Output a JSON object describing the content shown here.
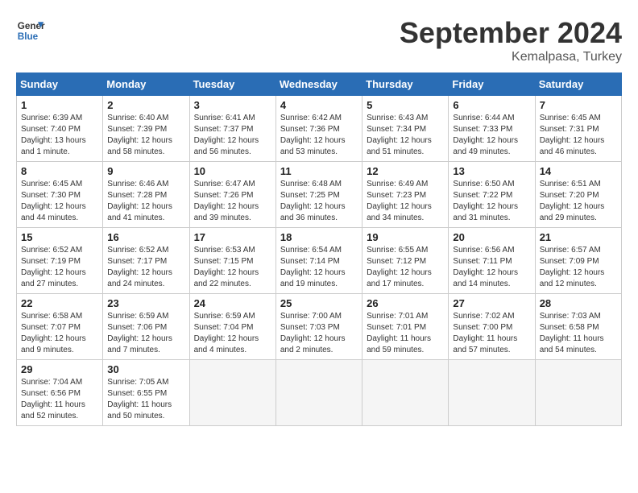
{
  "header": {
    "month_title": "September 2024",
    "location": "Kemalpasa, Turkey",
    "logo_line1": "General",
    "logo_line2": "Blue"
  },
  "weekdays": [
    "Sunday",
    "Monday",
    "Tuesday",
    "Wednesday",
    "Thursday",
    "Friday",
    "Saturday"
  ],
  "weeks": [
    [
      {
        "day": "1",
        "info": "Sunrise: 6:39 AM\nSunset: 7:40 PM\nDaylight: 13 hours\nand 1 minute."
      },
      {
        "day": "2",
        "info": "Sunrise: 6:40 AM\nSunset: 7:39 PM\nDaylight: 12 hours\nand 58 minutes."
      },
      {
        "day": "3",
        "info": "Sunrise: 6:41 AM\nSunset: 7:37 PM\nDaylight: 12 hours\nand 56 minutes."
      },
      {
        "day": "4",
        "info": "Sunrise: 6:42 AM\nSunset: 7:36 PM\nDaylight: 12 hours\nand 53 minutes."
      },
      {
        "day": "5",
        "info": "Sunrise: 6:43 AM\nSunset: 7:34 PM\nDaylight: 12 hours\nand 51 minutes."
      },
      {
        "day": "6",
        "info": "Sunrise: 6:44 AM\nSunset: 7:33 PM\nDaylight: 12 hours\nand 49 minutes."
      },
      {
        "day": "7",
        "info": "Sunrise: 6:45 AM\nSunset: 7:31 PM\nDaylight: 12 hours\nand 46 minutes."
      }
    ],
    [
      {
        "day": "8",
        "info": "Sunrise: 6:45 AM\nSunset: 7:30 PM\nDaylight: 12 hours\nand 44 minutes."
      },
      {
        "day": "9",
        "info": "Sunrise: 6:46 AM\nSunset: 7:28 PM\nDaylight: 12 hours\nand 41 minutes."
      },
      {
        "day": "10",
        "info": "Sunrise: 6:47 AM\nSunset: 7:26 PM\nDaylight: 12 hours\nand 39 minutes."
      },
      {
        "day": "11",
        "info": "Sunrise: 6:48 AM\nSunset: 7:25 PM\nDaylight: 12 hours\nand 36 minutes."
      },
      {
        "day": "12",
        "info": "Sunrise: 6:49 AM\nSunset: 7:23 PM\nDaylight: 12 hours\nand 34 minutes."
      },
      {
        "day": "13",
        "info": "Sunrise: 6:50 AM\nSunset: 7:22 PM\nDaylight: 12 hours\nand 31 minutes."
      },
      {
        "day": "14",
        "info": "Sunrise: 6:51 AM\nSunset: 7:20 PM\nDaylight: 12 hours\nand 29 minutes."
      }
    ],
    [
      {
        "day": "15",
        "info": "Sunrise: 6:52 AM\nSunset: 7:19 PM\nDaylight: 12 hours\nand 27 minutes."
      },
      {
        "day": "16",
        "info": "Sunrise: 6:52 AM\nSunset: 7:17 PM\nDaylight: 12 hours\nand 24 minutes."
      },
      {
        "day": "17",
        "info": "Sunrise: 6:53 AM\nSunset: 7:15 PM\nDaylight: 12 hours\nand 22 minutes."
      },
      {
        "day": "18",
        "info": "Sunrise: 6:54 AM\nSunset: 7:14 PM\nDaylight: 12 hours\nand 19 minutes."
      },
      {
        "day": "19",
        "info": "Sunrise: 6:55 AM\nSunset: 7:12 PM\nDaylight: 12 hours\nand 17 minutes."
      },
      {
        "day": "20",
        "info": "Sunrise: 6:56 AM\nSunset: 7:11 PM\nDaylight: 12 hours\nand 14 minutes."
      },
      {
        "day": "21",
        "info": "Sunrise: 6:57 AM\nSunset: 7:09 PM\nDaylight: 12 hours\nand 12 minutes."
      }
    ],
    [
      {
        "day": "22",
        "info": "Sunrise: 6:58 AM\nSunset: 7:07 PM\nDaylight: 12 hours\nand 9 minutes."
      },
      {
        "day": "23",
        "info": "Sunrise: 6:59 AM\nSunset: 7:06 PM\nDaylight: 12 hours\nand 7 minutes."
      },
      {
        "day": "24",
        "info": "Sunrise: 6:59 AM\nSunset: 7:04 PM\nDaylight: 12 hours\nand 4 minutes."
      },
      {
        "day": "25",
        "info": "Sunrise: 7:00 AM\nSunset: 7:03 PM\nDaylight: 12 hours\nand 2 minutes."
      },
      {
        "day": "26",
        "info": "Sunrise: 7:01 AM\nSunset: 7:01 PM\nDaylight: 11 hours\nand 59 minutes."
      },
      {
        "day": "27",
        "info": "Sunrise: 7:02 AM\nSunset: 7:00 PM\nDaylight: 11 hours\nand 57 minutes."
      },
      {
        "day": "28",
        "info": "Sunrise: 7:03 AM\nSunset: 6:58 PM\nDaylight: 11 hours\nand 54 minutes."
      }
    ],
    [
      {
        "day": "29",
        "info": "Sunrise: 7:04 AM\nSunset: 6:56 PM\nDaylight: 11 hours\nand 52 minutes."
      },
      {
        "day": "30",
        "info": "Sunrise: 7:05 AM\nSunset: 6:55 PM\nDaylight: 11 hours\nand 50 minutes."
      },
      {
        "day": "",
        "info": ""
      },
      {
        "day": "",
        "info": ""
      },
      {
        "day": "",
        "info": ""
      },
      {
        "day": "",
        "info": ""
      },
      {
        "day": "",
        "info": ""
      }
    ]
  ]
}
